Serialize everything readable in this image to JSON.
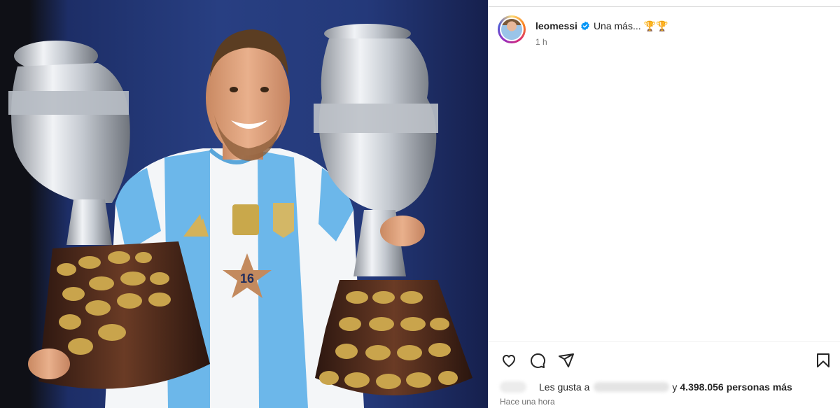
{
  "post": {
    "username": "leomessi",
    "caption": "Una más... 🏆🏆",
    "time_short": "1 h",
    "time_long": "Hace una hora"
  },
  "photo": {
    "jersey_number": "16"
  },
  "likes": {
    "prefix": "Les gusta a",
    "connector": "y",
    "count": "4.398.056",
    "suffix": "personas más"
  },
  "icons": {
    "like": "heart-icon",
    "comment": "comment-icon",
    "share": "send-icon",
    "save": "bookmark-icon",
    "verified": "verified-badge-icon"
  },
  "colors": {
    "verified": "#0095f6",
    "text": "#262626",
    "muted": "#737373"
  }
}
